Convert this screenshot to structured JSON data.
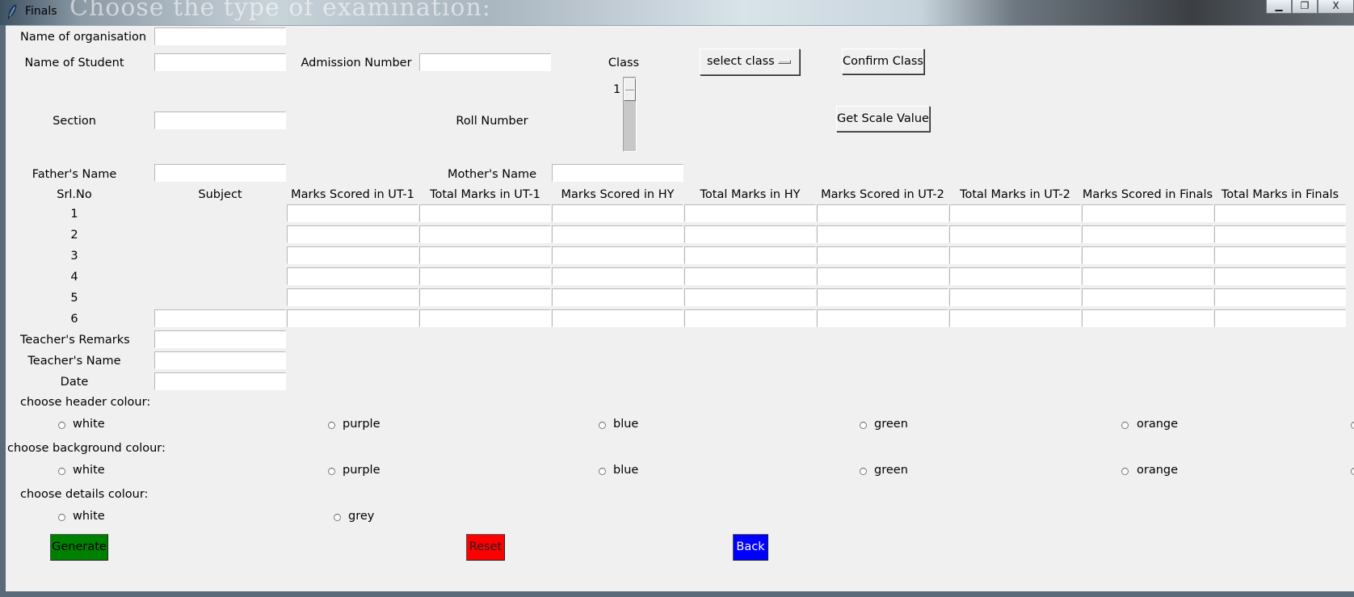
{
  "window": {
    "title": "Finals",
    "background_text": "Choose the type of examination:",
    "controls": {
      "minimize": "▁",
      "maximize": "❐",
      "close": "X"
    }
  },
  "form": {
    "organisation_label": "Name of organisation",
    "student_label": "Name of Student",
    "admission_label": "Admission Number",
    "class_label": "Class",
    "class_select": "select class",
    "confirm_class_button": "Confirm Class",
    "section_label": "Section",
    "roll_label": "Roll Number",
    "roll_scale_value": "1",
    "get_scale_button": "Get Scale Value",
    "father_label": "Father's Name",
    "mother_label": "Mother's Name"
  },
  "marks_table": {
    "headers": [
      "Srl.No",
      "Subject",
      "Marks Scored in UT-1",
      "Total Marks in UT-1",
      "Marks Scored in HY",
      "Total Marks in HY",
      "Marks Scored in UT-2",
      "Total Marks in UT-2",
      "Marks Scored in Finals",
      "Total Marks in Finals"
    ],
    "rows": [
      "1",
      "2",
      "3",
      "4",
      "5",
      "6"
    ]
  },
  "footer_fields": {
    "remarks_label": "Teacher's Remarks",
    "teacher_name_label": "Teacher's Name",
    "date_label": "Date"
  },
  "header_colour": {
    "label": "choose header colour:",
    "options": [
      "white",
      "purple",
      "blue",
      "green",
      "orange"
    ]
  },
  "background_colour": {
    "label": "choose background colour:",
    "options": [
      "white",
      "purple",
      "blue",
      "green",
      "orange"
    ]
  },
  "details_colour": {
    "label": "choose details colour:",
    "options": [
      "white",
      "grey"
    ]
  },
  "actions": {
    "generate": "Generate",
    "reset": "Reset",
    "back": "Back"
  },
  "colors": {
    "generate": "#008000",
    "reset": "#ff0000",
    "back": "#0000ff"
  }
}
